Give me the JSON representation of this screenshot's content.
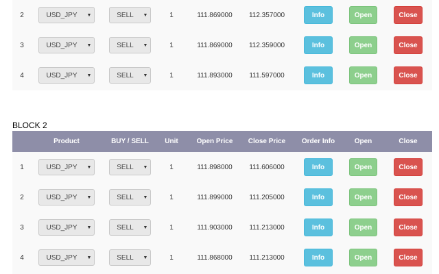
{
  "block1": {
    "rows": [
      {
        "index": "2",
        "product": "USD_JPY",
        "side": "SELL",
        "unit": "1",
        "open_price": "111.869000",
        "close_price": "112.357000",
        "info": "Info",
        "open": "Open",
        "close": "Close"
      },
      {
        "index": "3",
        "product": "USD_JPY",
        "side": "SELL",
        "unit": "1",
        "open_price": "111.869000",
        "close_price": "112.359000",
        "info": "Info",
        "open": "Open",
        "close": "Close"
      },
      {
        "index": "4",
        "product": "USD_JPY",
        "side": "SELL",
        "unit": "1",
        "open_price": "111.893000",
        "close_price": "111.597000",
        "info": "Info",
        "open": "Open",
        "close": "Close"
      }
    ]
  },
  "block2": {
    "title": "BLOCK 2",
    "headers": {
      "product": "Product",
      "side": "BUY / SELL",
      "unit": "Unit",
      "open_price": "Open Price",
      "close_price": "Close Price",
      "order_info": "Order Info",
      "open": "Open",
      "close": "Close"
    },
    "rows": [
      {
        "index": "1",
        "product": "USD_JPY",
        "side": "SELL",
        "unit": "1",
        "open_price": "111.898000",
        "close_price": "111.606000",
        "info": "Info",
        "open": "Open",
        "close": "Close"
      },
      {
        "index": "2",
        "product": "USD_JPY",
        "side": "SELL",
        "unit": "1",
        "open_price": "111.899000",
        "close_price": "111.205000",
        "info": "Info",
        "open": "Open",
        "close": "Close"
      },
      {
        "index": "3",
        "product": "USD_JPY",
        "side": "SELL",
        "unit": "1",
        "open_price": "111.903000",
        "close_price": "111.213000",
        "info": "Info",
        "open": "Open",
        "close": "Close"
      },
      {
        "index": "4",
        "product": "USD_JPY",
        "side": "SELL",
        "unit": "1",
        "open_price": "111.868000",
        "close_price": "111.213000",
        "info": "Info",
        "open": "Open",
        "close": "Close"
      }
    ]
  },
  "colors": {
    "header_bg": "#8e8ea8",
    "info": "#5bc0de",
    "open": "#8dcf8d",
    "close": "#d9534f"
  }
}
